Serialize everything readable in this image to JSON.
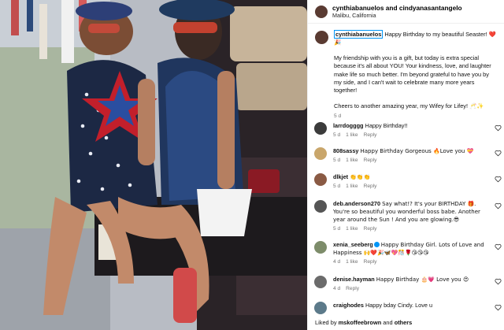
{
  "post": {
    "header": {
      "users": "cynthiabanuelos and cindyanasantangelo",
      "location": "Malibu, California"
    },
    "caption": {
      "username": "cynthiabanuelos",
      "line1": "Happy Birthday to my beautiful Seaster! ❤️🎉",
      "paragraph1": "My friendship with you is a gift, but today is extra special because it's all about YOU! Your kindness, love, and laughter make life so much better. I'm beyond grateful to have you by my side, and I can't wait to celebrate many more years together!",
      "paragraph2": "Cheers to another amazing year, my Wifey for Lifey! 🥂✨",
      "time": "5 d"
    },
    "comments": [
      {
        "user": "larrdogggg",
        "text": "Happy Birthday!!",
        "time": "5 d",
        "likes": "1 like",
        "reply": "Reply",
        "avatar_color": "#3b3b3b"
      },
      {
        "user": "808sassy",
        "text": "Happy Birthday Gorgeous 🔥Love you 💝",
        "time": "5 d",
        "likes": "1 like",
        "reply": "Reply",
        "avatar_color": "#c9a66b"
      },
      {
        "user": "dlkjet",
        "text": "👏👏👏",
        "time": "5 d",
        "likes": "1 like",
        "reply": "Reply",
        "avatar_color": "#8a5a44"
      },
      {
        "user": "deb.anderson270",
        "text": "Say what!? It's your BIRTHDAY 🎁. You're so beautiful you wonderful boss babe. Another year around the Sun ! And you are glowing.😎",
        "time": "5 d",
        "likes": "1 like",
        "reply": "Reply",
        "avatar_color": "#555555"
      },
      {
        "user": "xenia_seeberg",
        "text": "Happy Birthday Girl. Lots of Love and Happiness 🙌❤️🎉🦋💖🎊🌹😘😘😘",
        "time": "4 d",
        "likes": "1 like",
        "reply": "Reply",
        "avatar_color": "#7d8c6a"
      },
      {
        "user": "denise.hayman",
        "text": "Happy Birthday 🎂💗 Love you 😍",
        "time": "4 d",
        "likes": "",
        "reply": "Reply",
        "avatar_color": "#6b6b6b"
      },
      {
        "user": "craighodes",
        "text": "Happy bday Cindy. Love u",
        "time": "5 d",
        "likes": "1 like",
        "reply": "Reply",
        "avatar_color": "#5c7a8a"
      }
    ],
    "liked_by": {
      "prefix": "Liked by",
      "user": "mskoffeebrown",
      "and": "and",
      "others": "others"
    },
    "header_avatar_color": "#5a3b32",
    "accent_color": "#0095f6"
  }
}
